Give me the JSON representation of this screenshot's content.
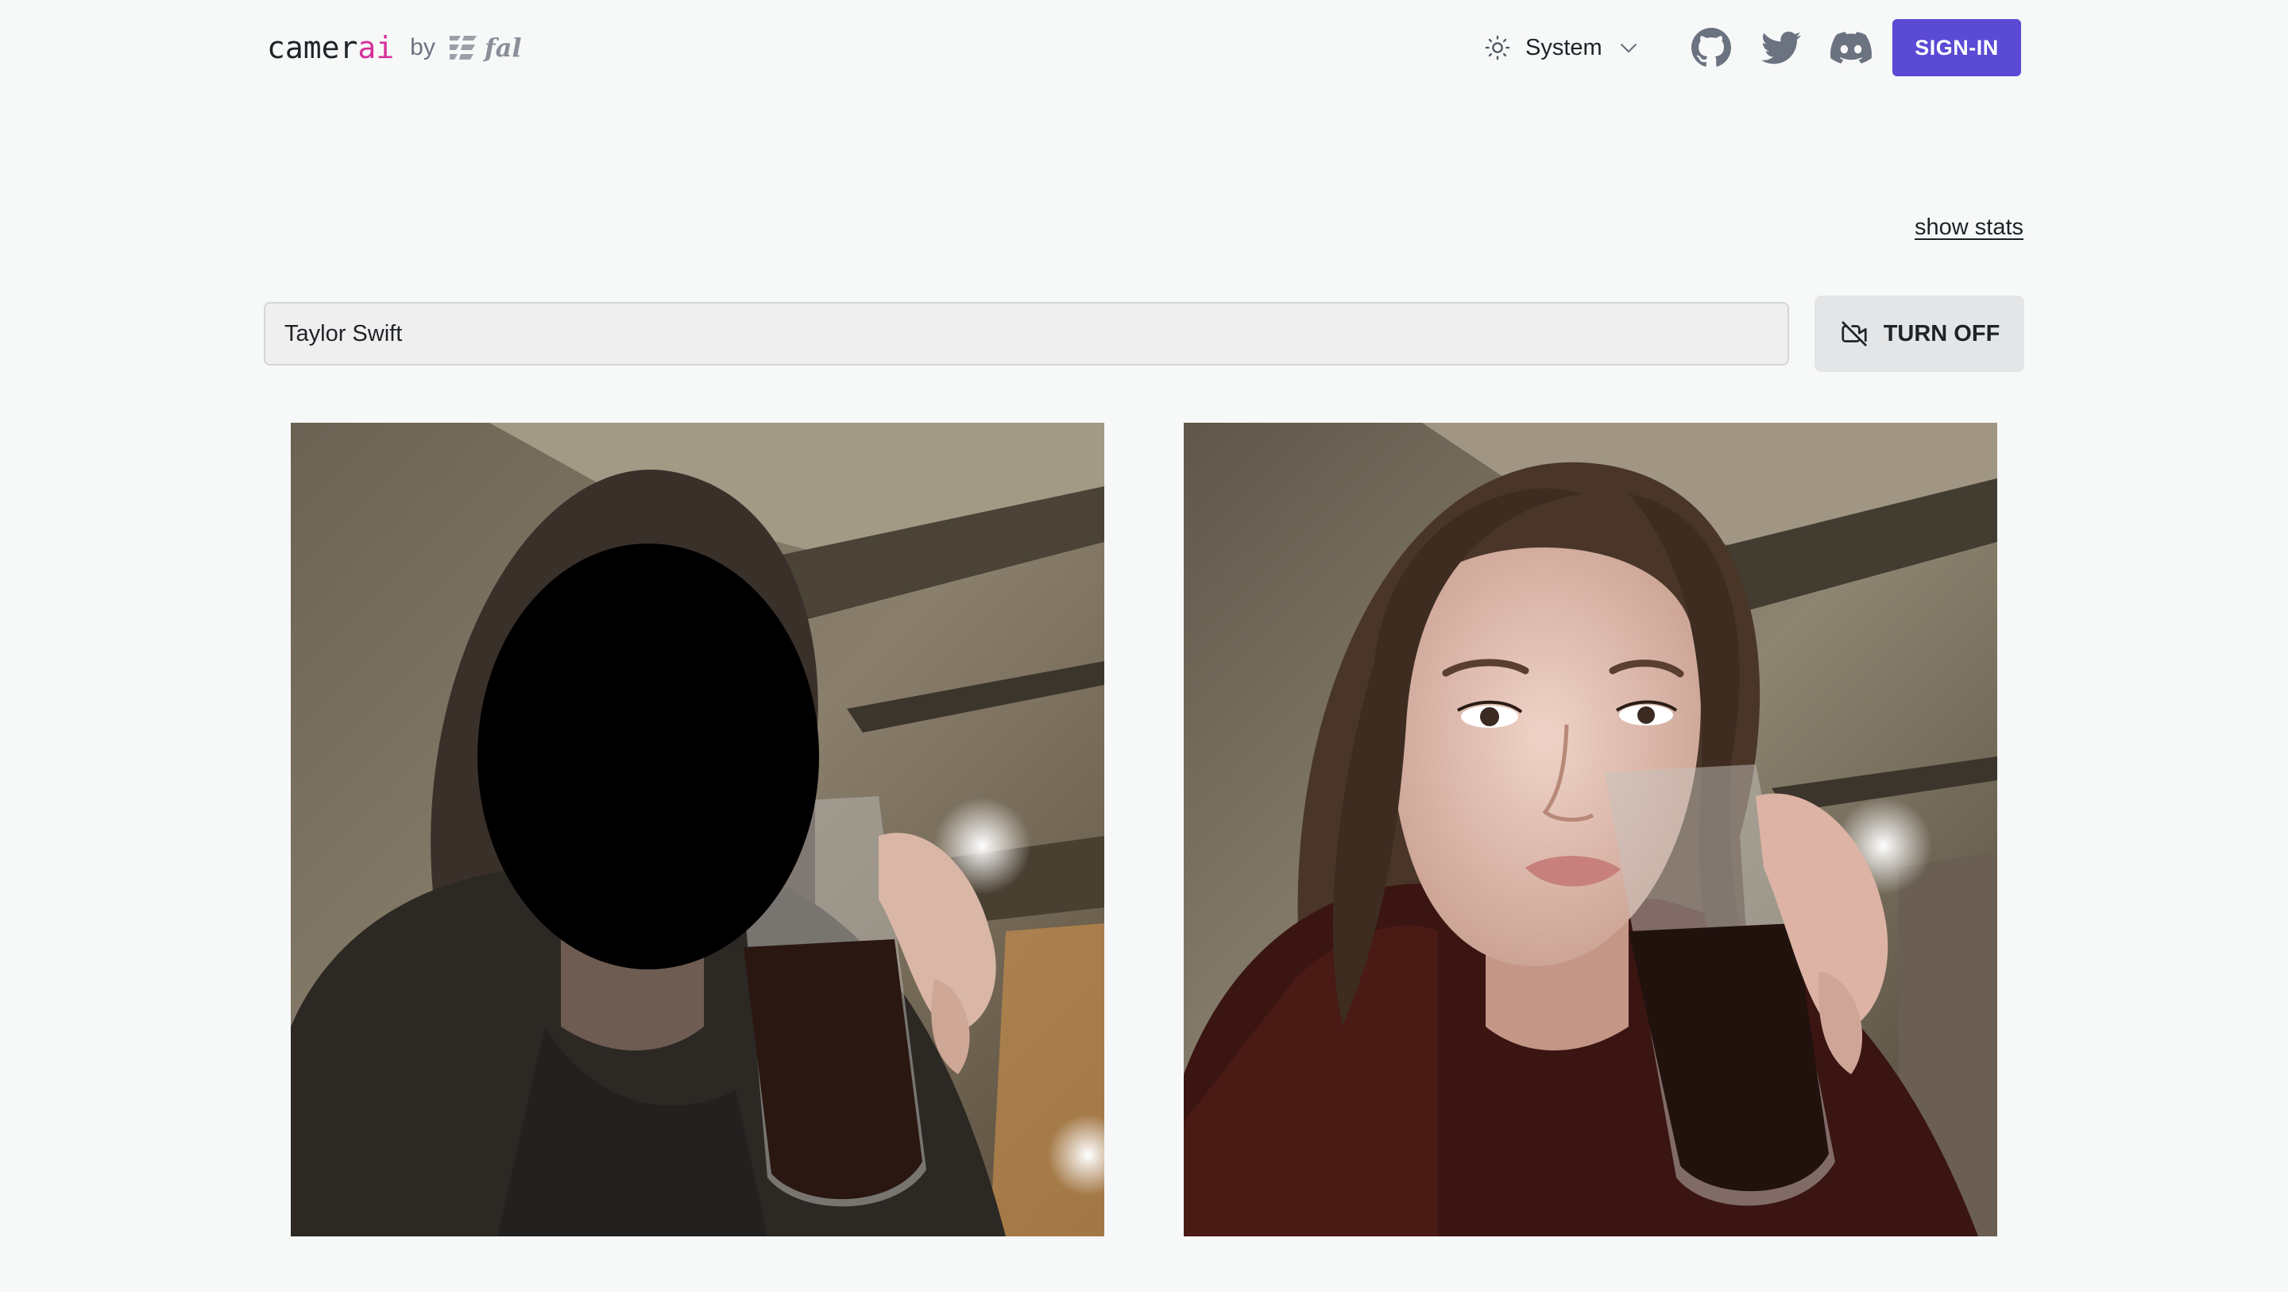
{
  "header": {
    "brand_prefix": "camer",
    "brand_suffix": "ai",
    "by": "by",
    "partner": "fal",
    "theme_label": "System",
    "signin_label": "SIGN-IN",
    "icons": [
      "github-icon",
      "twitter-icon",
      "discord-icon",
      "sun-icon",
      "chevron-down-icon"
    ]
  },
  "stats_link": "show stats",
  "prompt": {
    "value": "Taylor Swift"
  },
  "camera_button": {
    "label": "TURN OFF",
    "icon": "video-off-icon"
  },
  "colors": {
    "accent": "#5a4ad4",
    "brand_highlight": "#d6309a",
    "background": "#f7f8f8"
  }
}
